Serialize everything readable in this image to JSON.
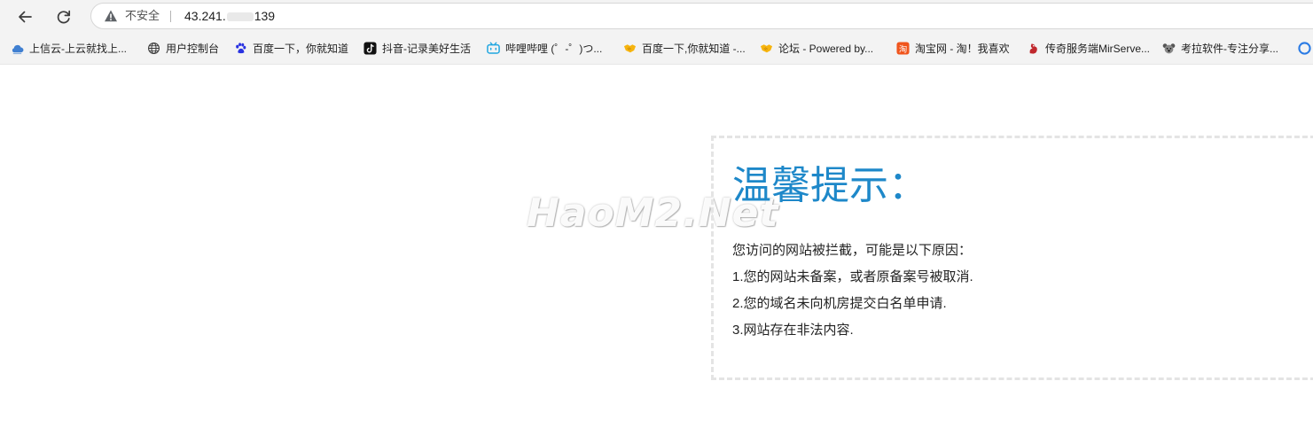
{
  "toolbar": {
    "security_label": "不安全",
    "url_prefix": "43.241.",
    "url_suffix": "139",
    "colors": {
      "warning": "#5f6368"
    }
  },
  "bookmarks": [
    {
      "label": "上信云-上云就找上...",
      "icon": "cloud-icon"
    },
    {
      "label": "用户控制台",
      "icon": "globe-icon"
    },
    {
      "label": "百度一下，你就知道",
      "icon": "baidu-paw-icon"
    },
    {
      "label": "抖音-记录美好生活",
      "icon": "tiktok-icon"
    },
    {
      "label": "哔哩哔哩 (゜-゜)つ...",
      "icon": "bilibili-tv-icon"
    },
    {
      "label": "百度一下,你就知道 -...",
      "icon": "handshake-icon"
    },
    {
      "label": "论坛 - Powered by...",
      "icon": "handshake-icon"
    },
    {
      "label": "淘宝网 - 淘！我喜欢",
      "icon": "taobao-icon"
    },
    {
      "label": "传奇服务端MirServe...",
      "icon": "dragon-icon"
    },
    {
      "label": "考拉软件-专注分享...",
      "icon": "koala-icon"
    }
  ],
  "notice": {
    "title": "温馨提示：",
    "lines": [
      "您访问的网站被拦截，可能是以下原因：",
      "1.您的网站未备案，或者原备案号被取消.",
      "2.您的域名未向机房提交白名单申请.",
      "3.网站存在非法内容."
    ],
    "title_color": "#1e88c9"
  },
  "watermark": {
    "text": "HaoM2.Net"
  }
}
